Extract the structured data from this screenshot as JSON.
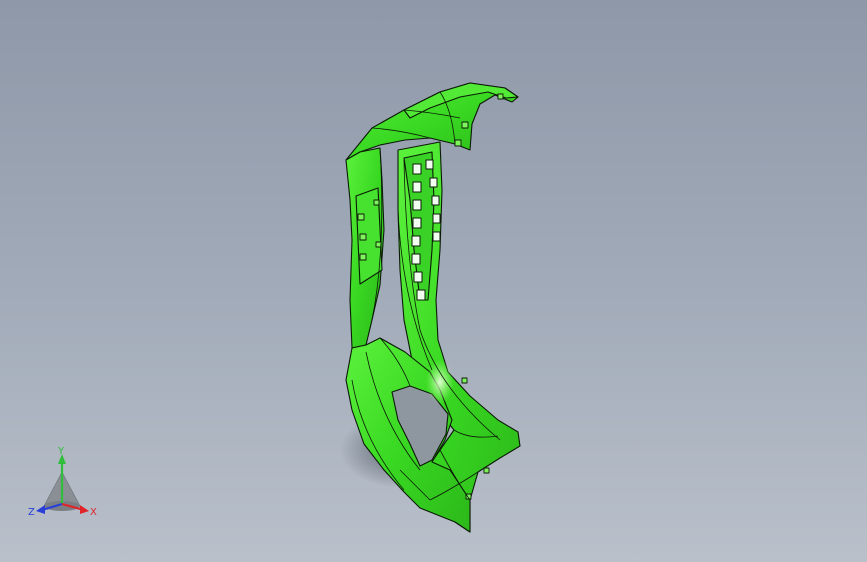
{
  "viewport": {
    "background_top": "#8e98a8",
    "background_bottom": "#b9c0ca",
    "model": {
      "fill": "#3fe02a",
      "highlight": "#9bff7a",
      "edge": "#0b1a06",
      "shadow": "#5f6875"
    }
  },
  "triad": {
    "axes": {
      "x": {
        "label": "X",
        "color": "#e0242a"
      },
      "y": {
        "label": "Y",
        "color": "#2fbf3a"
      },
      "z": {
        "label": "Z",
        "color": "#2a3fd8"
      }
    },
    "icons": [
      "view-orientation-triad-icon"
    ]
  }
}
